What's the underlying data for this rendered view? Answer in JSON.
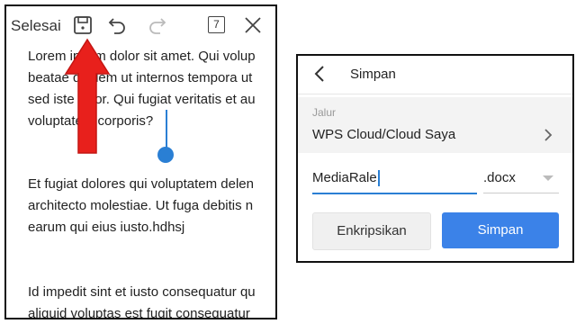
{
  "editor": {
    "toolbar": {
      "done_label": "Selesai",
      "page_count": "7",
      "icons": [
        "save-icon",
        "undo-icon",
        "redo-icon",
        "page-count-icon",
        "close-icon"
      ]
    },
    "paragraphs": [
      [
        "Lorem ipsum dolor sit amet. Qui volup",
        "beatae quidem ut internos tempora ut",
        "sed iste error. Qui fugiat veritatis et au",
        "voluptatem corporis?"
      ],
      [
        "Et fugiat dolores qui voluptatem delen",
        "architecto molestiae. Ut fuga debitis n",
        "earum qui eius iusto.hdhsj"
      ],
      [
        "Id impedit sint et iusto consequatur qu",
        "aliquid voluptas est fugit consequatur"
      ]
    ],
    "annotation_color": "#e8201c",
    "accent": "#2a7fd4"
  },
  "save_dialog": {
    "title": "Simpan",
    "path_label": "Jalur",
    "path_value": "WPS Cloud/Cloud Saya",
    "filename_value": "MediaRale",
    "extension_value": ".docx",
    "encrypt_label": "Enkripsikan",
    "save_label": "Simpan",
    "save_color": "#3b82e8"
  }
}
